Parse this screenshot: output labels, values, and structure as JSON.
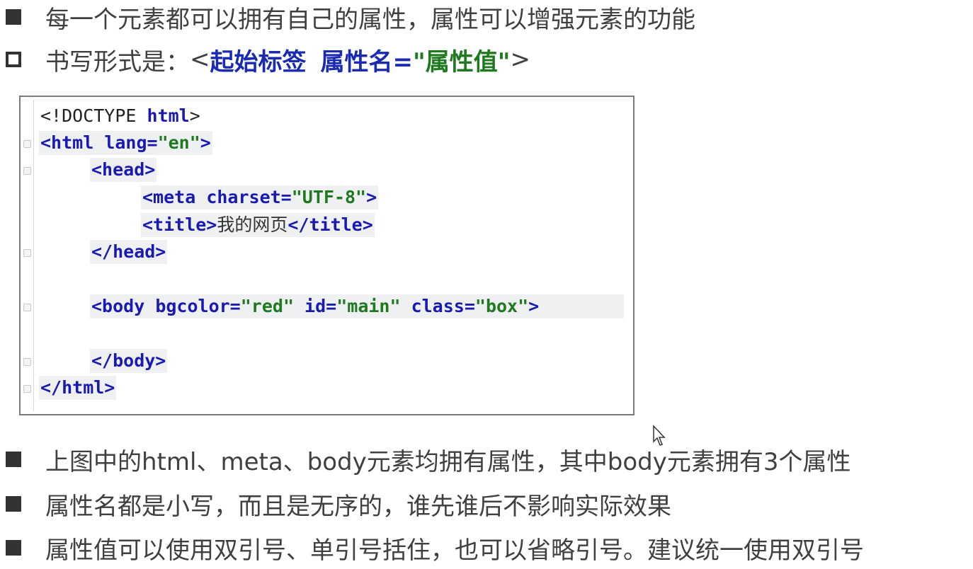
{
  "bullets_top": [
    {
      "text": "每一个元素都可以拥有自己的属性，属性可以增强元素的功能"
    },
    {
      "prefix": "书写形式是：",
      "lt": "<",
      "tag": "起始标签",
      "attr_name": "属性名=",
      "attr_value": "\"属性值\"",
      "gt": ">"
    }
  ],
  "code": {
    "l1_a": "<!DOCTYPE ",
    "l1_b": "html",
    "l1_c": ">",
    "l2_a": "<html ",
    "l2_b": "lang=",
    "l2_c": "\"en\"",
    "l2_d": ">",
    "l3": "<head>",
    "l4_a": "<meta ",
    "l4_b": "charset=",
    "l4_c": "\"UTF-8\"",
    "l4_d": ">",
    "l5_a": "<title>",
    "l5_b": "我的网页",
    "l5_c": "</title>",
    "l6": "</head>",
    "l7_a": "<body ",
    "l7_b": "bgcolor=",
    "l7_c": "\"red\"",
    "l7_d": " id=",
    "l7_e": "\"main\"",
    "l7_f": " class=",
    "l7_g": "\"box\"",
    "l7_h": ">",
    "l8": "</body>",
    "l9": "</html>"
  },
  "bullets_bottom": [
    "上图中的html、meta、body元素均拥有属性，其中body元素拥有3个属性",
    "属性名都是小写，而且是无序的，谁先谁后不影响实际效果",
    "属性值可以使用双引号、单引号括住，也可以省略引号。建议统一使用双引号"
  ]
}
